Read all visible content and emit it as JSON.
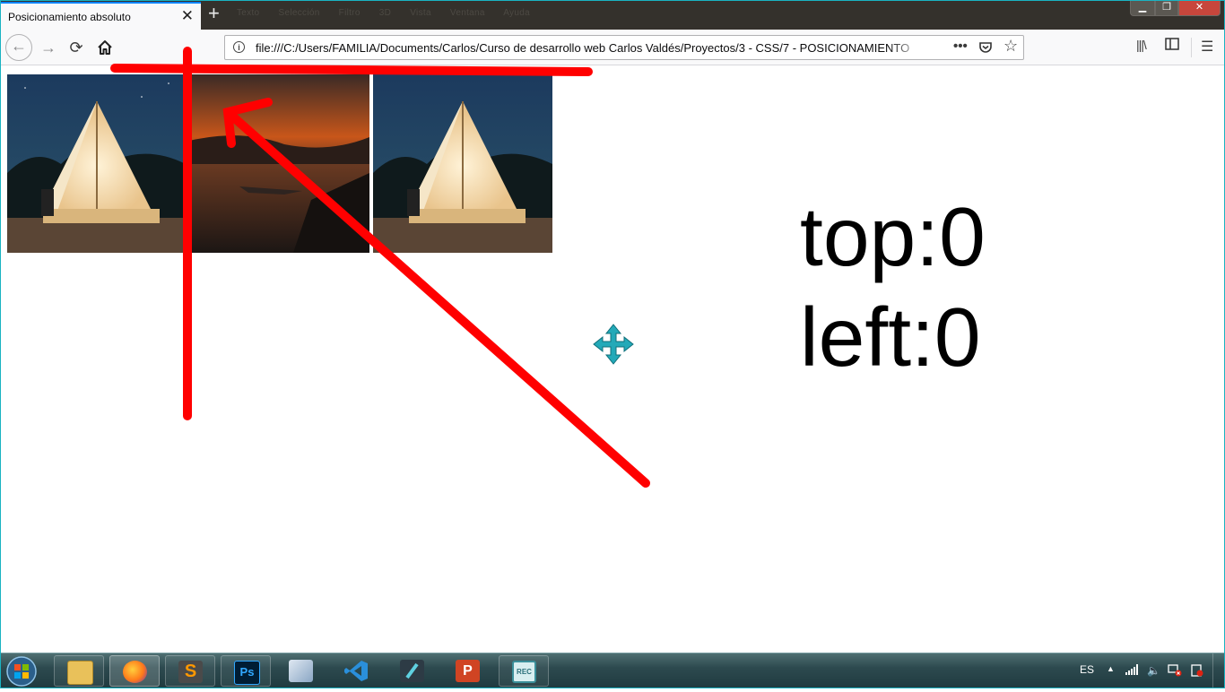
{
  "browser": {
    "tab_title": "Posicionamiento absoluto",
    "tab_close_glyph": "✕",
    "newtab_glyph": "+",
    "ghost_menu": [
      "Texto",
      "Selección",
      "Filtro",
      "3D",
      "Vista",
      "Ventana",
      "Ayuda"
    ],
    "url": "file:///C:/Users/FAMILIA/Documents/Carlos/Curso de desarrollo web Carlos Valdés/Proyectos/3 - CSS/7 - POSICIONAMIENTO",
    "icons": {
      "back": "arrow-left-icon",
      "forward": "arrow-right-icon",
      "reload": "reload-icon",
      "home": "home-icon",
      "info": "info-icon",
      "page_actions": "more-icon",
      "pocket": "pocket-icon",
      "bookmark": "star-icon",
      "library": "library-icon",
      "sidebar": "sidebar-icon",
      "menu": "hamburger-icon"
    }
  },
  "page": {
    "line1": "top:0",
    "line2": "left:0",
    "images": [
      "tent-photo",
      "sunset-photo",
      "tent-photo"
    ]
  },
  "annotation": {
    "color": "#ff0000"
  },
  "taskbar": {
    "language": "ES",
    "apps": [
      "file-explorer",
      "firefox",
      "sublime-text",
      "photoshop",
      "virtualbox",
      "vscode",
      "filmora",
      "powerpoint",
      "screen-recorder"
    ],
    "photoshop_label": "Ps",
    "recorder_label": "REC"
  }
}
